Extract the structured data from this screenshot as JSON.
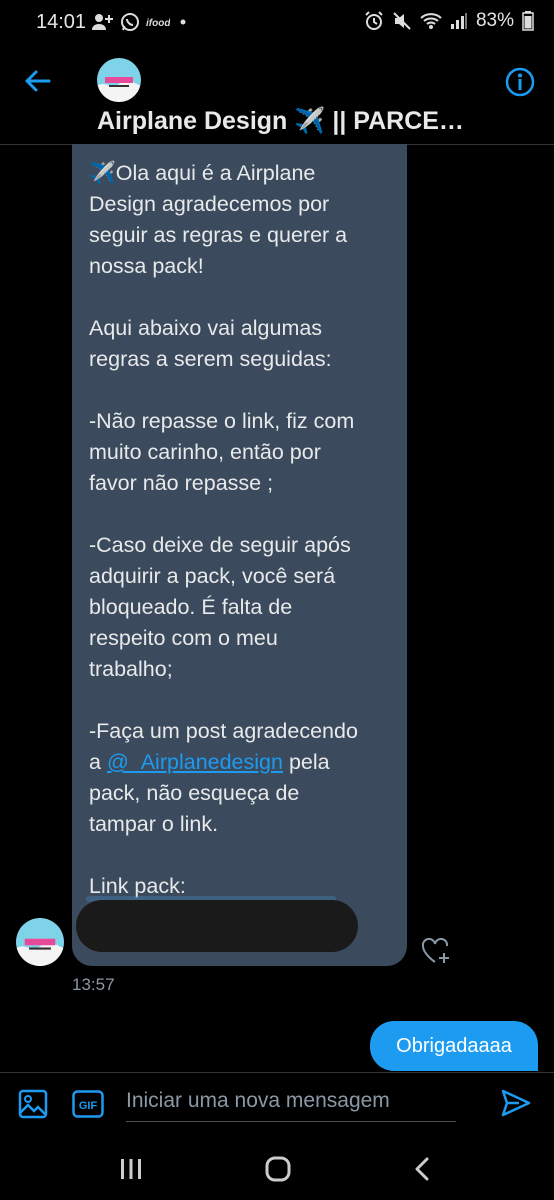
{
  "status_bar": {
    "time": "14:01",
    "battery": "83%",
    "left_icons": [
      "add-person-icon",
      "whatsapp-icon",
      "ifood-icon",
      "dot-icon"
    ],
    "right_icons": [
      "alarm-icon",
      "mute-icon",
      "wifi-icon",
      "signal-icon",
      "battery-icon"
    ]
  },
  "header": {
    "title": "Airplane Design ✈️ || PARCE…",
    "accent_color": "#1d9bf0"
  },
  "message_in": {
    "lines": [
      "✈️Ola aqui é a Airplane",
      "Design agradecemos por",
      "seguir as regras e querer a",
      "nossa pack!",
      "",
      "Aqui abaixo vai algumas",
      "regras a serem seguidas:",
      "",
      "-Não repasse o link, fiz com",
      "muito carinho, então por",
      "favor não repasse ;",
      "",
      "-Caso deixe de seguir após",
      "adquirir a pack, você será",
      "bloqueado. É falta de",
      "respeito com o meu",
      "trabalho;",
      "",
      "-Faça um post agradecendo"
    ],
    "mention_prefix": "a ",
    "mention": "@_Airplanedesign",
    "mention_suffix": " pela",
    "lines_after": [
      "pack, não esqueça de",
      "tampar o link.",
      "",
      "Link pack:"
    ],
    "timestamp": "13:57",
    "bubble_color": "#3b4a5c"
  },
  "message_out": {
    "text": "Obrigadaaaa",
    "bubble_color": "#1d9bf0"
  },
  "composer": {
    "placeholder": "Iniciar uma nova mensagem",
    "gif_label": "GIF"
  }
}
